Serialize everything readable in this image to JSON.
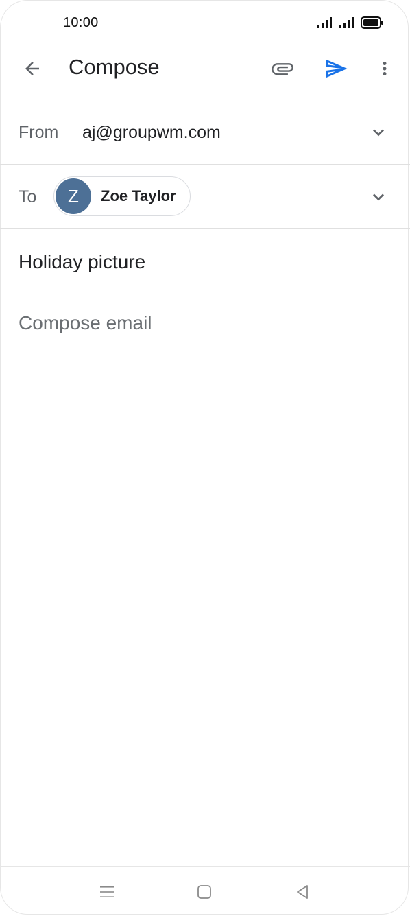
{
  "status_bar": {
    "time": "10:00",
    "icons": [
      "signal-icon",
      "signal-icon",
      "battery-icon"
    ]
  },
  "app_bar": {
    "title": "Compose",
    "back_icon": "arrow-left-icon",
    "attach_icon": "paperclip-icon",
    "send_icon": "send-icon",
    "more_icon": "more-vert-icon"
  },
  "from": {
    "label": "From",
    "value": "aj@groupwm.com"
  },
  "to": {
    "label": "To",
    "recipient": {
      "initial": "Z",
      "name": "Zoe Taylor"
    }
  },
  "subject": {
    "value": "Holiday picture"
  },
  "body": {
    "placeholder": "Compose email"
  },
  "colors": {
    "accent": "#1a73e8",
    "avatar": "#4d7096",
    "divider": "#e0e0e0",
    "secondary_text": "#5f6368"
  },
  "nav_bar": {
    "icons": [
      "menu-icon",
      "home-icon",
      "back-triangle-icon"
    ]
  }
}
